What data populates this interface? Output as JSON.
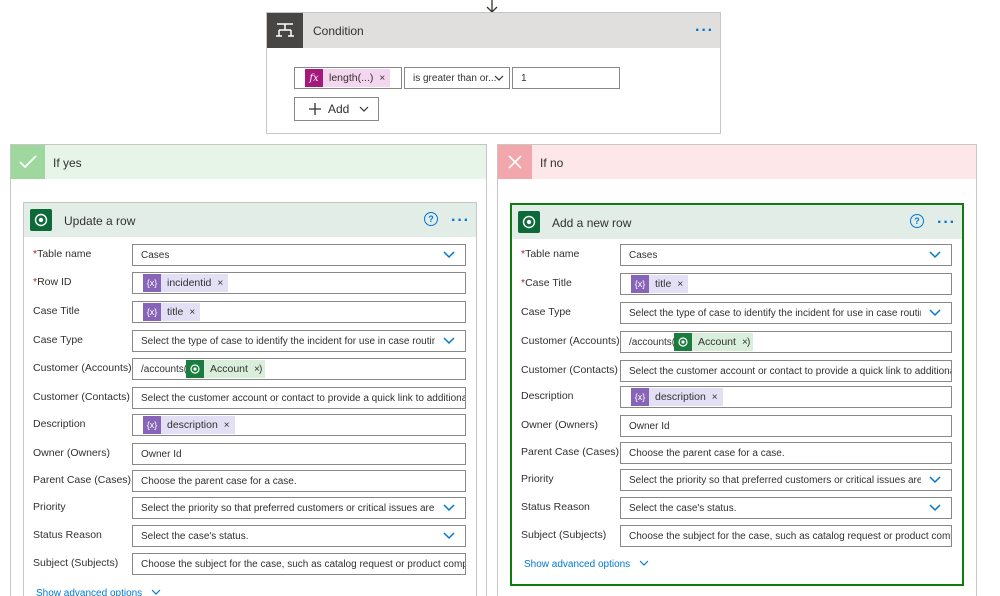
{
  "condition": {
    "title": "Condition",
    "left_operand": "length(...)",
    "operator": "is greater than or...",
    "right_operand": "1",
    "add_label": "Add"
  },
  "branches": {
    "yes_label": "If yes",
    "no_label": "If no"
  },
  "update_card": {
    "title": "Update a row",
    "fields": {
      "table_name": {
        "label": "Table name",
        "value": "Cases"
      },
      "row_id": {
        "label": "Row ID",
        "token": "incidentid"
      },
      "case_title": {
        "label": "Case Title",
        "token": "title"
      },
      "case_type": {
        "label": "Case Type",
        "value": "Select the type of case to identify the incident for use in case routing and"
      },
      "customer_accounts": {
        "label": "Customer (Accounts)",
        "prefix": "/accounts(",
        "token": "Account",
        "suffix": ")"
      },
      "customer_contacts": {
        "label": "Customer (Contacts)",
        "value": "Select the customer account or contact to provide a quick link to additional cus"
      },
      "description": {
        "label": "Description",
        "token": "description"
      },
      "owner": {
        "label": "Owner (Owners)",
        "value": "Owner Id"
      },
      "parent_case": {
        "label": "Parent Case (Cases)",
        "value": "Choose the parent case for a case."
      },
      "priority": {
        "label": "Priority",
        "value": "Select the priority so that preferred customers or critical issues are handle"
      },
      "status_reason": {
        "label": "Status Reason",
        "value": "Select the case's status."
      },
      "subject": {
        "label": "Subject (Subjects)",
        "value": "Choose the subject for the case, such as catalog request or product complaint, :"
      }
    },
    "show_advanced": "Show advanced options"
  },
  "add_card": {
    "title": "Add a new row",
    "fields": {
      "table_name": {
        "label": "Table name",
        "value": "Cases"
      },
      "case_title": {
        "label": "Case Title",
        "token": "title"
      },
      "case_type": {
        "label": "Case Type",
        "value": "Select the type of case to identify the incident for use in case routing anc"
      },
      "customer_accounts": {
        "label": "Customer (Accounts)",
        "prefix": "/accounts(",
        "token": "Account",
        "suffix": ")"
      },
      "customer_contacts": {
        "label": "Customer (Contacts)",
        "value": "Select the customer account or contact to provide a quick link to additional cus"
      },
      "description": {
        "label": "Description",
        "token": "description"
      },
      "owner": {
        "label": "Owner (Owners)",
        "value": "Owner Id"
      },
      "parent_case": {
        "label": "Parent Case (Cases)",
        "value": "Choose the parent case for a case."
      },
      "priority": {
        "label": "Priority",
        "value": "Select the priority so that preferred customers or critical issues are handl•"
      },
      "status_reason": {
        "label": "Status Reason",
        "value": "Select the case's status."
      },
      "subject": {
        "label": "Subject (Subjects)",
        "value": "Choose the subject for the case, such as catalog request or product complaint,"
      }
    },
    "show_advanced": "Show advanced options"
  },
  "required_marker": "*",
  "remove_glyph": "×",
  "help_glyph": "?",
  "more_glyph": "···",
  "colors": {
    "accent": "#0078d4",
    "dataverse_green": "#0b6a38",
    "yes_bg": "#e6f5e7",
    "no_bg": "#fde7e9",
    "expression": "#a4197c",
    "variable": "#8764b8"
  }
}
